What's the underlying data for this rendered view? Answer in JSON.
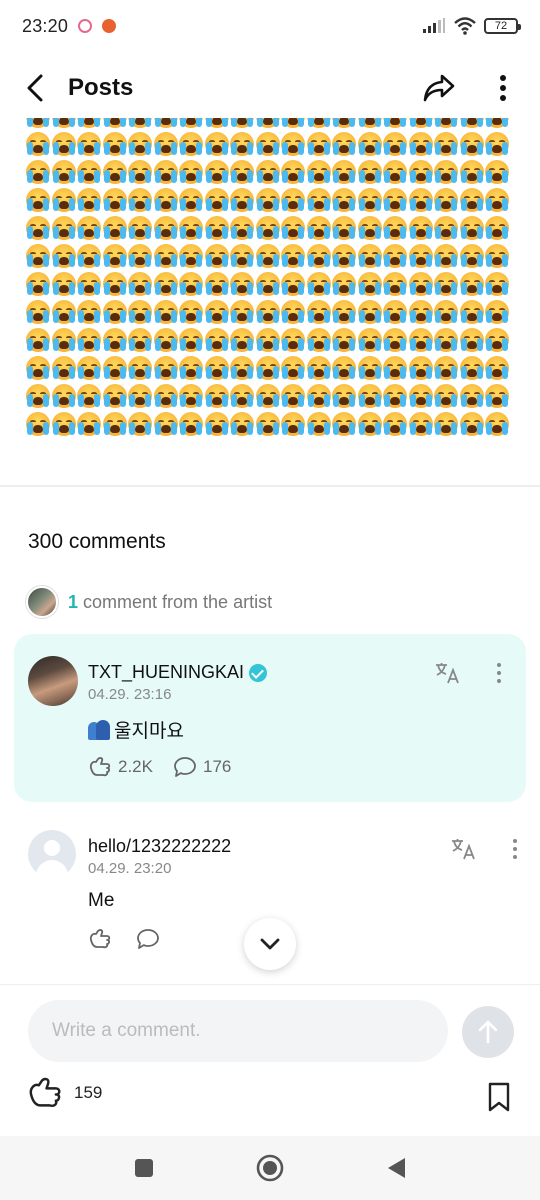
{
  "status_bar": {
    "time": "23:20",
    "battery": "72",
    "icons": [
      "notification-messenger-icon",
      "notification-app-icon",
      "signal-icon",
      "wifi-icon",
      "battery-icon"
    ]
  },
  "header": {
    "title": "Posts",
    "icons": [
      "back-arrow-icon",
      "share-icon",
      "more-vertical-icon"
    ]
  },
  "post": {
    "emoji_name": "loudly-crying-face-emoji",
    "columns": 19,
    "rows": 12
  },
  "comments": {
    "count_label": "300 comments",
    "artist_summary": {
      "count": "1",
      "label": "comment from the artist"
    },
    "items": [
      {
        "author": "TXT_HUENINGKAI",
        "verified": true,
        "time": "04.29. 23:16",
        "text": "울지마요",
        "text_emoji": "people-hugging-icon",
        "likes": "2.2K",
        "replies": "176",
        "highlight_color": "#e6fbf8"
      },
      {
        "author": "hello/1232222222",
        "verified": false,
        "time": "04.29. 23:20",
        "text": "Me",
        "likes": "",
        "replies": ""
      }
    ]
  },
  "composer": {
    "placeholder": "Write a comment."
  },
  "footer": {
    "like_count": "159"
  },
  "colors": {
    "accent": "#1bb8b0",
    "verified": "#33c4d6",
    "artist_card_bg": "#e6fbf8"
  }
}
